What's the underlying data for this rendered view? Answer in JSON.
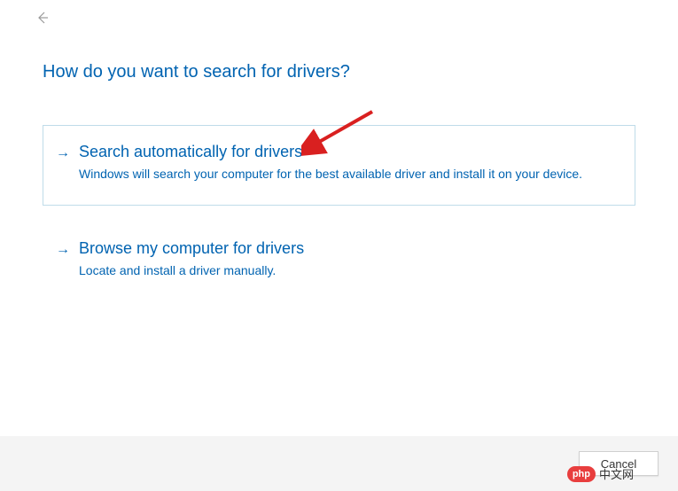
{
  "heading": "How do you want to search for drivers?",
  "options": [
    {
      "title": "Search automatically for drivers",
      "desc": "Windows will search your computer for the best available driver and install it on your device."
    },
    {
      "title": "Browse my computer for drivers",
      "desc": "Locate and install a driver manually."
    }
  ],
  "footer": {
    "cancel_label": "Cancel"
  },
  "watermark": {
    "badge": "php",
    "text": "中文网"
  }
}
